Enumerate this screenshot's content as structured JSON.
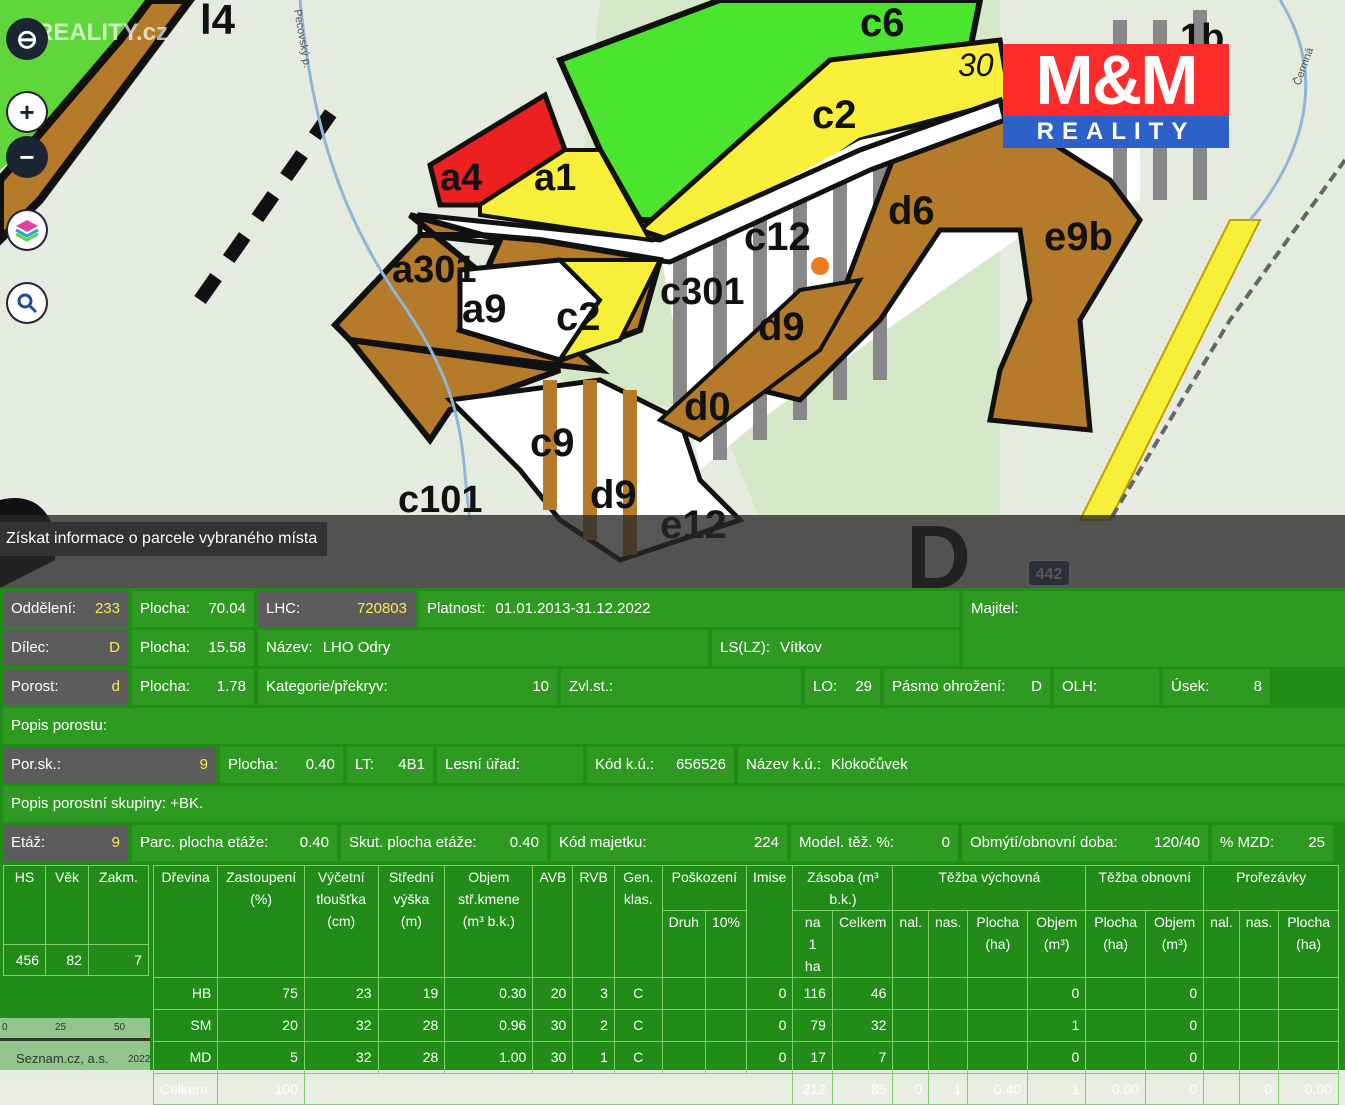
{
  "map": {
    "brand": "REALITY.cz",
    "parcel_labels": [
      "l4",
      "c6",
      "c2",
      "a4",
      "a1",
      "30",
      "1b",
      "d6",
      "c12",
      "e9b",
      "a301",
      "a9",
      "c2",
      "c301",
      "d9",
      "d0",
      "c9",
      "c101",
      "d9",
      "e12",
      "D"
    ],
    "road_badge": "442",
    "stream_label_1": "Pecovský p.",
    "stream_label_2": "Čermná",
    "copyright": "Seznam.cz, a.s.",
    "copyright_year": "2022",
    "scale_ticks": [
      "0",
      "25",
      "50"
    ]
  },
  "controls": {
    "zoom_in": "+",
    "zoom_out": "−"
  },
  "logo": {
    "top": "M&M",
    "bottom": "REALITY"
  },
  "banner": "Získat informace o parcele vybraného místa",
  "info": {
    "oddeleni_label": "Oddělení:",
    "oddeleni": "233",
    "plocha1_label": "Plocha:",
    "plocha1": "70.04",
    "lhc_label": "LHC:",
    "lhc": "720803",
    "platnost_label": "Platnost:",
    "platnost": "01.01.2013-31.12.2022",
    "majitel_label": "Majitel:",
    "dilec_label": "Dílec:",
    "dilec": "D",
    "plocha2_label": "Plocha:",
    "plocha2": "15.58",
    "nazev_label": "Název:",
    "nazev": "LHO Odry",
    "ls_label": "LS(LZ):",
    "ls": "Vítkov",
    "porost_label": "Porost:",
    "porost": "d",
    "plocha3_label": "Plocha:",
    "plocha3": "1.78",
    "kategorie_label": "Kategorie/překryv:",
    "kategorie": "10",
    "zvlst_label": "Zvl.st.:",
    "lo_label": "LO:",
    "lo": "29",
    "pasmo_label": "Pásmo ohrožení:",
    "pasmo": "D",
    "olh_label": "OLH:",
    "usek_label": "Úsek:",
    "usek": "8",
    "popis_porostu_label": "Popis porostu:",
    "porsk_label": "Por.sk.:",
    "porsk": "9",
    "plocha4_label": "Plocha:",
    "plocha4": "0.40",
    "lt_label": "LT:",
    "lt": "4B1",
    "lesni_urad_label": "Lesní úřad:",
    "kod_ku_label": "Kód k.ú.:",
    "kod_ku": "656526",
    "nazev_ku_label": "Název k.ú.:",
    "nazev_ku": "Klokočůvek",
    "popis_skupiny_label": "Popis porostní skupiny:",
    "popis_skupiny": "+BK.",
    "etaz_label": "Etáž:",
    "etaz": "9",
    "parc_plocha_label": "Parc. plocha etáže:",
    "parc_plocha": "0.40",
    "skut_plocha_label": "Skut. plocha etáže:",
    "skut_plocha": "0.40",
    "kod_majetku_label": "Kód majetku:",
    "kod_majetku": "224",
    "model_label": "Model. těž. %:",
    "model": "0",
    "obmyti_label": "Obmýtí/obnovní doba:",
    "obmyti": "120/40",
    "mzd_label": "% MZD:",
    "mzd": "25"
  },
  "left_table": {
    "headers": [
      "HS",
      "Věk",
      "Zakm."
    ],
    "row": [
      "456",
      "82",
      "7"
    ]
  },
  "tree_table": {
    "h_drevina": "Dřevina",
    "h_zastoupeni": "Zastoupení (%)",
    "h_vycetni": "Výčetní tloušťka (cm)",
    "h_stredni": "Střední výška (m)",
    "h_objem": "Objem stř.kmene (m³ b.k.)",
    "h_avb": "AVB",
    "h_rvb": "RVB",
    "h_gen": "Gen. klas.",
    "h_poskozeni": "Poškození",
    "h_druh": "Druh",
    "h_10": "10%",
    "h_imise": "Imise",
    "h_zasoba": "Zásoba (m³ b.k.)",
    "h_na1ha": "na 1 ha",
    "h_celkem": "Celkem",
    "h_tezba_vych": "Těžba výchovná",
    "h_tezba_obn": "Těžba obnovní",
    "h_prorezavky": "Prořezávky",
    "h_nal": "nal.",
    "h_nas": "nas.",
    "h_plocha_ha": "Plocha (ha)",
    "h_objem_m3": "Objem (m³)",
    "rows": [
      [
        "HB",
        "75",
        "23",
        "19",
        "0.30",
        "20",
        "3",
        "C",
        "",
        "",
        "0",
        "116",
        "46",
        "",
        "",
        "",
        "0",
        "",
        "0",
        "",
        "",
        ""
      ],
      [
        "SM",
        "20",
        "32",
        "28",
        "0.96",
        "30",
        "2",
        "C",
        "",
        "",
        "0",
        "79",
        "32",
        "",
        "",
        "",
        "1",
        "",
        "0",
        "",
        "",
        ""
      ],
      [
        "MD",
        "5",
        "32",
        "28",
        "1.00",
        "30",
        "1",
        "C",
        "",
        "",
        "0",
        "17",
        "7",
        "",
        "",
        "",
        "0",
        "",
        "0",
        "",
        "",
        ""
      ]
    ],
    "total_label": "Celkem:",
    "total_zastoupeni": "100",
    "total_na1ha": "212",
    "total_celkem": "85",
    "total_nal": "0",
    "total_nas": "1",
    "total_plocha": "0.40",
    "total_objem": "1",
    "total_obn_plocha": "0.00",
    "total_obn_objem": "0",
    "total_pr_nas": "0",
    "total_pr_plocha": "0.00"
  }
}
